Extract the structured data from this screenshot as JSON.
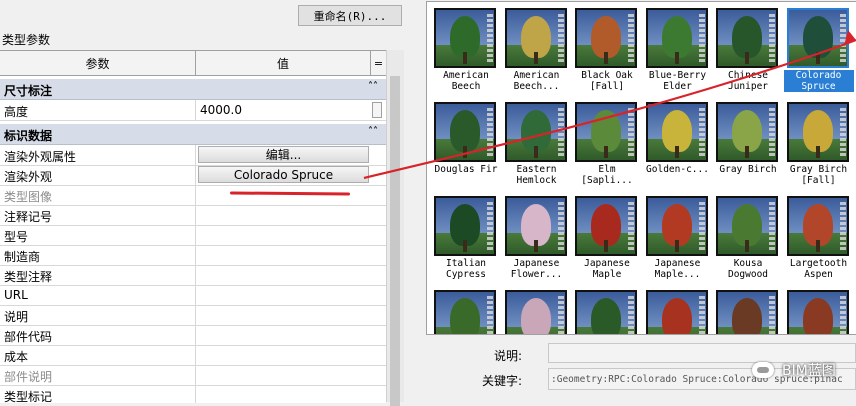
{
  "toolbar": {
    "rename_label": "重命名(R)..."
  },
  "panel_title": "类型参数",
  "grid": {
    "col_param": "参数",
    "col_value": "值",
    "col_toggle": "="
  },
  "sections": [
    {
      "title": "尺寸标注",
      "rows": [
        {
          "name": "高度",
          "value": "4000.0"
        }
      ]
    },
    {
      "title": "标识数据",
      "rows": [
        {
          "name": "渲染外观属性",
          "button": "编辑..."
        },
        {
          "name": "渲染外观",
          "button": "Colorado Spruce"
        },
        {
          "name": "类型图像",
          "value": ""
        },
        {
          "name": "注释记号",
          "value": ""
        },
        {
          "name": "型号",
          "value": ""
        },
        {
          "name": "制造商",
          "value": ""
        },
        {
          "name": "类型注释",
          "value": ""
        },
        {
          "name": "URL",
          "value": ""
        },
        {
          "name": "说明",
          "value": ""
        },
        {
          "name": "部件代码",
          "value": ""
        },
        {
          "name": "成本",
          "value": ""
        },
        {
          "name": "部件说明",
          "value": ""
        },
        {
          "name": "类型标记",
          "value": ""
        }
      ]
    }
  ],
  "gallery": [
    {
      "label": "American Beech",
      "color": "#2e6b2a"
    },
    {
      "label": "American Beech...",
      "color": "#c0a448"
    },
    {
      "label": "Black Oak [Fall]",
      "color": "#b25b2a"
    },
    {
      "label": "Blue-Berry Elder",
      "color": "#3c7a32"
    },
    {
      "label": "Chinese Juniper",
      "color": "#26562a"
    },
    {
      "label": "Colorado Spruce",
      "color": "#1f4f3a",
      "selected": true
    },
    {
      "label": "Douglas Fir",
      "color": "#2a5a2a"
    },
    {
      "label": "Eastern Hemlock",
      "color": "#2f6a38"
    },
    {
      "label": "Elm [Sapli...",
      "color": "#5b8a3a"
    },
    {
      "label": "Golden-c...",
      "color": "#c8b43a"
    },
    {
      "label": "Gray Birch",
      "color": "#8aa448"
    },
    {
      "label": "Gray Birch [Fall]",
      "color": "#c8a838"
    },
    {
      "label": "Italian Cypress",
      "color": "#1c4a24"
    },
    {
      "label": "Japanese Flower...",
      "color": "#d6b6c8"
    },
    {
      "label": "Japanese Maple",
      "color": "#a82a1e"
    },
    {
      "label": "Japanese Maple...",
      "color": "#b23a22"
    },
    {
      "label": "Kousa Dogwood",
      "color": "#4a7a32"
    },
    {
      "label": "Largetooth Aspen",
      "color": "#b2462a"
    },
    {
      "label": "",
      "color": "#3a6a2a"
    },
    {
      "label": "",
      "color": "#c9a6b8"
    },
    {
      "label": "",
      "color": "#2a5a28"
    },
    {
      "label": "",
      "color": "#a83220"
    },
    {
      "label": "",
      "color": "#6a3a24"
    },
    {
      "label": "",
      "color": "#8a3a22"
    }
  ],
  "details": {
    "desc_label": "说明:",
    "desc_value": "",
    "keywords_label": "关键字:",
    "keywords_value": ":Geometry:RPC:Colorado Spruce:Colorado spruce:pinac"
  },
  "watermark": {
    "text": "BIM蓝图"
  },
  "colors": {
    "accent": "#2a7fd4",
    "annotation_red": "#d8232a"
  }
}
